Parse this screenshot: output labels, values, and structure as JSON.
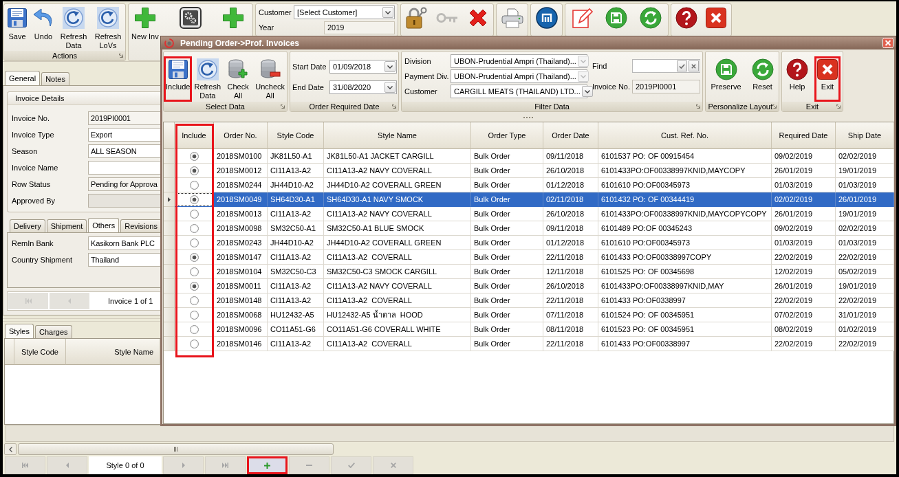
{
  "main_window": {
    "ribbon": [
      {
        "kind": "buttons",
        "title": "Actions",
        "items": [
          {
            "label": "Save",
            "disabled": false
          },
          {
            "label": "Undo",
            "disabled": false
          },
          {
            "label": "Refresh Data",
            "disabled": false
          },
          {
            "label": "Refresh LoVs",
            "disabled": false
          }
        ]
      },
      {
        "kind": "buttons",
        "items": [
          {
            "label": "New Inv",
            "disabled": false
          },
          {
            "disabled": false
          },
          {
            "disabled": false
          }
        ]
      },
      {
        "kind": "fields",
        "fields": [
          {
            "kind": "dropdown",
            "label": "Customer",
            "value": "[Select Customer]"
          },
          {
            "kind": "text",
            "label": "Year",
            "value": "2019"
          }
        ]
      },
      {
        "kind": "buttons",
        "items": [
          {
            "disabled": false
          },
          {
            "disabled": true
          },
          {
            "disabled": false
          }
        ]
      },
      {
        "kind": "buttons",
        "items": [
          {
            "disabled": false
          }
        ]
      },
      {
        "kind": "buttons",
        "items": [
          {
            "disabled": false
          }
        ]
      },
      {
        "kind": "buttons",
        "items": [
          {
            "disabled": false
          },
          {
            "disabled": false
          },
          {
            "disabled": false
          }
        ]
      },
      {
        "kind": "buttons",
        "items": [
          {
            "disabled": false
          },
          {
            "disabled": false
          }
        ]
      }
    ],
    "left_panel": {
      "tabs": [
        {
          "label": "General",
          "selected": true
        },
        {
          "label": "Notes",
          "selected": false
        }
      ],
      "invoice_details": {
        "title": "Invoice Details",
        "fields": [
          {
            "label": "Invoice No.",
            "value": "2019PI0001",
            "kind": "readonly"
          },
          {
            "label": "Invoice Type",
            "value": "Export",
            "kind": "editable"
          },
          {
            "label": "Season",
            "value": "ALL SEASON",
            "kind": "editable"
          },
          {
            "label": "Invoice Name",
            "kind": "editable"
          },
          {
            "label": "Row Status",
            "value": "Pending for Approva",
            "kind": "readonly"
          },
          {
            "label": "Approved By",
            "kind": "disabled"
          }
        ]
      },
      "detail_tabs": [
        {
          "label": "Delivery",
          "selected": false
        },
        {
          "label": "Shipment",
          "selected": false
        },
        {
          "label": "Others",
          "selected": true
        },
        {
          "label": "Revisions",
          "selected": false
        }
      ],
      "others_fields": [
        {
          "label": "RemIn Bank",
          "value": "Kasikorn Bank PLC"
        },
        {
          "label": "Country Shipment",
          "value": "Thailand"
        }
      ],
      "invoice_navigator": [
        {
          "kind": "button",
          "disabled": true
        },
        {
          "kind": "button",
          "disabled": true
        },
        {
          "kind": "position",
          "text": "Invoice 1 of 1"
        }
      ],
      "lower_tabs": [
        {
          "label": "Styles",
          "selected": true
        },
        {
          "label": "Charges",
          "selected": false
        }
      ],
      "styles_table": {
        "columns": [
          "Style Code",
          "Style Name"
        ]
      }
    },
    "bottom_bar": {
      "navigator": [
        {
          "kind": "button",
          "disabled": true,
          "highlighted": false
        },
        {
          "kind": "button",
          "disabled": true,
          "highlighted": false
        },
        {
          "kind": "position",
          "text": "Style 0 of 0"
        },
        {
          "kind": "button",
          "disabled": true,
          "highlighted": false
        },
        {
          "kind": "button",
          "disabled": true,
          "highlighted": false
        },
        {
          "kind": "button",
          "disabled": false,
          "highlighted": true
        },
        {
          "kind": "button",
          "disabled": true,
          "highlighted": false
        },
        {
          "kind": "button",
          "disabled": true,
          "highlighted": false
        },
        {
          "kind": "button",
          "disabled": true,
          "highlighted": false
        }
      ]
    }
  },
  "dialog": {
    "title": "Pending Order->Prof. Invoices",
    "ribbon": {
      "select_data": {
        "title": "Select Data",
        "buttons": [
          {
            "label": "Include",
            "highlighted": true
          },
          {
            "label": "Refresh Data",
            "highlighted": false
          },
          {
            "label": "Check All",
            "highlighted": false
          },
          {
            "label": "Uncheck All",
            "highlighted": false
          }
        ]
      },
      "order_required_date": {
        "title": "Order Required Date",
        "fields": [
          {
            "label": "Start Date",
            "value": "01/09/2018"
          },
          {
            "label": "End Date",
            "value": "31/08/2020"
          }
        ]
      },
      "filter_data": {
        "title": "Filter Data",
        "dropdowns": [
          {
            "label": "Division",
            "value": "UBON-Prudential Ampri (Thailand)...",
            "disabled": true
          },
          {
            "label": "Payment Div.",
            "value": "UBON-Prudential Ampri (Thailand)...",
            "disabled": true
          },
          {
            "label": "Customer",
            "value": "CARGILL MEATS (THAILAND) LTD...",
            "disabled": false
          }
        ],
        "find": {
          "label": "Find"
        },
        "invoice_no": {
          "label": "Invoice No.",
          "value": "2019PI0001"
        }
      },
      "personalize_layout": {
        "title": "Personalize Layout",
        "buttons": [
          {
            "label": "Preserve",
            "highlighted": false
          },
          {
            "label": "Reset",
            "highlighted": false
          }
        ]
      },
      "exit": {
        "title": "Exit",
        "buttons": [
          {
            "label": "Help",
            "highlighted": false
          },
          {
            "label": "Exit",
            "highlighted": true
          }
        ]
      }
    },
    "table": {
      "columns": [
        {
          "label": "Include",
          "highlighted": true
        },
        {
          "label": "Order No.",
          "highlighted": false
        },
        {
          "label": "Style Code",
          "highlighted": false
        },
        {
          "label": "Style Name",
          "highlighted": false
        },
        {
          "label": "Order Type",
          "highlighted": false
        },
        {
          "label": "Order Date",
          "highlighted": false
        },
        {
          "label": "Cust. Ref. No.",
          "highlighted": false
        },
        {
          "label": "Required Date",
          "highlighted": false
        },
        {
          "label": "Ship Date",
          "highlighted": false
        }
      ],
      "rows": [
        {
          "selected": false,
          "cells": [
            {
              "kind": "radio",
              "checked": true
            },
            "2018SM0100",
            "JK81L50-A1",
            "JK81L50-A1 JACKET CARGILL",
            "Bulk Order",
            "09/11/2018",
            "6101537 PO: OF 00915454",
            "09/02/2019",
            "02/02/2019"
          ]
        },
        {
          "selected": false,
          "cells": [
            {
              "kind": "radio",
              "checked": true
            },
            "2018SM0012",
            "CI11A13-A2",
            "CI11A13-A2 NAVY COVERALL",
            "Bulk Order",
            "26/10/2018",
            "6101433PO:OF00338997KNID,MAYCOPY",
            "26/01/2019",
            "19/01/2019"
          ]
        },
        {
          "selected": false,
          "cells": [
            {
              "kind": "radio",
              "checked": false
            },
            "2018SM0244",
            "JH44D10-A2",
            "JH44D10-A2 COVERALL GREEN",
            "Bulk Order",
            "01/12/2018",
            "6101610 PO:OF00345973",
            "01/03/2019",
            "01/03/2019"
          ]
        },
        {
          "selected": true,
          "cells": [
            {
              "kind": "radio",
              "checked": true
            },
            "2018SM0049",
            "SH64D30-A1",
            "SH64D30-A1 NAVY SMOCK",
            "Bulk Order",
            "02/11/2018",
            "6101432 PO: OF 00344419",
            "02/02/2019",
            "26/01/2019"
          ]
        },
        {
          "selected": false,
          "cells": [
            {
              "kind": "radio",
              "checked": false
            },
            "2018SM0013",
            "CI11A13-A2",
            "CI11A13-A2 NAVY COVERALL",
            "Bulk Order",
            "26/10/2018",
            "6101433PO:OF00338997KNID,MAYCOPYCOPY",
            "26/01/2019",
            "19/01/2019"
          ]
        },
        {
          "selected": false,
          "cells": [
            {
              "kind": "radio",
              "checked": false
            },
            "2018SM0098",
            "SM32C50-A1",
            "SM32C50-A1 BLUE SMOCK",
            "Bulk Order",
            "09/11/2018",
            "6101489 PO:OF 00345243",
            "09/02/2019",
            "02/02/2019"
          ]
        },
        {
          "selected": false,
          "cells": [
            {
              "kind": "radio",
              "checked": false
            },
            "2018SM0243",
            "JH44D10-A2",
            "JH44D10-A2 COVERALL GREEN",
            "Bulk Order",
            "01/12/2018",
            "6101610 PO:OF00345973",
            "01/03/2019",
            "01/03/2019"
          ]
        },
        {
          "selected": false,
          "cells": [
            {
              "kind": "radio",
              "checked": true
            },
            "2018SM0147",
            "CI11A13-A2",
            "CI11A13-A2  COVERALL",
            "Bulk Order",
            "22/11/2018",
            "6101433 PO:OF00338997COPY",
            "22/02/2019",
            "22/02/2019"
          ]
        },
        {
          "selected": false,
          "cells": [
            {
              "kind": "radio",
              "checked": false
            },
            "2018SM0104",
            "SM32C50-C3",
            "SM32C50-C3 SMOCK CARGILL",
            "Bulk Order",
            "12/11/2018",
            "6101525 PO: OF 00345698",
            "12/02/2019",
            "05/02/2019"
          ]
        },
        {
          "selected": false,
          "cells": [
            {
              "kind": "radio",
              "checked": true
            },
            "2018SM0011",
            "CI11A13-A2",
            "CI11A13-A2 NAVY COVERALL",
            "Bulk Order",
            "26/10/2018",
            "6101433PO:OF00338997KNID,MAY",
            "26/01/2019",
            "19/01/2019"
          ]
        },
        {
          "selected": false,
          "cells": [
            {
              "kind": "radio",
              "checked": false
            },
            "2018SM0148",
            "CI11A13-A2",
            "CI11A13-A2  COVERALL",
            "Bulk Order",
            "22/11/2018",
            "6101433 PO:OF0338997",
            "22/02/2019",
            "22/02/2019"
          ]
        },
        {
          "selected": false,
          "cells": [
            {
              "kind": "radio",
              "checked": false
            },
            "2018SM0068",
            "HU12432-A5",
            "HU12432-A5 น้ำตาล  HOOD",
            "Bulk Order",
            "07/11/2018",
            "6101524 PO: OF 00345951",
            "07/02/2019",
            "31/01/2019"
          ]
        },
        {
          "selected": false,
          "cells": [
            {
              "kind": "radio",
              "checked": false
            },
            "2018SM0096",
            "CO11A51-G6",
            "CO11A51-G6 COVERALL WHITE",
            "Bulk Order",
            "08/11/2018",
            "6101523 PO: OF 00345951",
            "08/02/2019",
            "01/02/2019"
          ]
        },
        {
          "selected": false,
          "cells": [
            {
              "kind": "radio",
              "checked": false
            },
            "2018SM0146",
            "CI11A13-A2",
            "CI11A13-A2  COVERALL",
            "Bulk Order",
            "22/11/2018",
            "6101433 PO:OF00338997",
            "22/02/2019",
            "22/02/2019"
          ]
        }
      ]
    }
  }
}
